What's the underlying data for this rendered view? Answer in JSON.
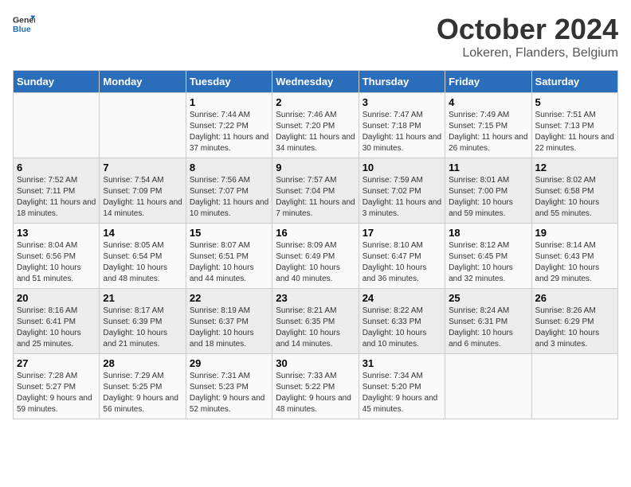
{
  "header": {
    "logo_line1": "General",
    "logo_line2": "Blue",
    "month": "October 2024",
    "location": "Lokeren, Flanders, Belgium"
  },
  "weekdays": [
    "Sunday",
    "Monday",
    "Tuesday",
    "Wednesday",
    "Thursday",
    "Friday",
    "Saturday"
  ],
  "weeks": [
    [
      {
        "day": "",
        "sunrise": "",
        "sunset": "",
        "daylight": ""
      },
      {
        "day": "",
        "sunrise": "",
        "sunset": "",
        "daylight": ""
      },
      {
        "day": "1",
        "sunrise": "Sunrise: 7:44 AM",
        "sunset": "Sunset: 7:22 PM",
        "daylight": "Daylight: 11 hours and 37 minutes."
      },
      {
        "day": "2",
        "sunrise": "Sunrise: 7:46 AM",
        "sunset": "Sunset: 7:20 PM",
        "daylight": "Daylight: 11 hours and 34 minutes."
      },
      {
        "day": "3",
        "sunrise": "Sunrise: 7:47 AM",
        "sunset": "Sunset: 7:18 PM",
        "daylight": "Daylight: 11 hours and 30 minutes."
      },
      {
        "day": "4",
        "sunrise": "Sunrise: 7:49 AM",
        "sunset": "Sunset: 7:15 PM",
        "daylight": "Daylight: 11 hours and 26 minutes."
      },
      {
        "day": "5",
        "sunrise": "Sunrise: 7:51 AM",
        "sunset": "Sunset: 7:13 PM",
        "daylight": "Daylight: 11 hours and 22 minutes."
      }
    ],
    [
      {
        "day": "6",
        "sunrise": "Sunrise: 7:52 AM",
        "sunset": "Sunset: 7:11 PM",
        "daylight": "Daylight: 11 hours and 18 minutes."
      },
      {
        "day": "7",
        "sunrise": "Sunrise: 7:54 AM",
        "sunset": "Sunset: 7:09 PM",
        "daylight": "Daylight: 11 hours and 14 minutes."
      },
      {
        "day": "8",
        "sunrise": "Sunrise: 7:56 AM",
        "sunset": "Sunset: 7:07 PM",
        "daylight": "Daylight: 11 hours and 10 minutes."
      },
      {
        "day": "9",
        "sunrise": "Sunrise: 7:57 AM",
        "sunset": "Sunset: 7:04 PM",
        "daylight": "Daylight: 11 hours and 7 minutes."
      },
      {
        "day": "10",
        "sunrise": "Sunrise: 7:59 AM",
        "sunset": "Sunset: 7:02 PM",
        "daylight": "Daylight: 11 hours and 3 minutes."
      },
      {
        "day": "11",
        "sunrise": "Sunrise: 8:01 AM",
        "sunset": "Sunset: 7:00 PM",
        "daylight": "Daylight: 10 hours and 59 minutes."
      },
      {
        "day": "12",
        "sunrise": "Sunrise: 8:02 AM",
        "sunset": "Sunset: 6:58 PM",
        "daylight": "Daylight: 10 hours and 55 minutes."
      }
    ],
    [
      {
        "day": "13",
        "sunrise": "Sunrise: 8:04 AM",
        "sunset": "Sunset: 6:56 PM",
        "daylight": "Daylight: 10 hours and 51 minutes."
      },
      {
        "day": "14",
        "sunrise": "Sunrise: 8:05 AM",
        "sunset": "Sunset: 6:54 PM",
        "daylight": "Daylight: 10 hours and 48 minutes."
      },
      {
        "day": "15",
        "sunrise": "Sunrise: 8:07 AM",
        "sunset": "Sunset: 6:51 PM",
        "daylight": "Daylight: 10 hours and 44 minutes."
      },
      {
        "day": "16",
        "sunrise": "Sunrise: 8:09 AM",
        "sunset": "Sunset: 6:49 PM",
        "daylight": "Daylight: 10 hours and 40 minutes."
      },
      {
        "day": "17",
        "sunrise": "Sunrise: 8:10 AM",
        "sunset": "Sunset: 6:47 PM",
        "daylight": "Daylight: 10 hours and 36 minutes."
      },
      {
        "day": "18",
        "sunrise": "Sunrise: 8:12 AM",
        "sunset": "Sunset: 6:45 PM",
        "daylight": "Daylight: 10 hours and 32 minutes."
      },
      {
        "day": "19",
        "sunrise": "Sunrise: 8:14 AM",
        "sunset": "Sunset: 6:43 PM",
        "daylight": "Daylight: 10 hours and 29 minutes."
      }
    ],
    [
      {
        "day": "20",
        "sunrise": "Sunrise: 8:16 AM",
        "sunset": "Sunset: 6:41 PM",
        "daylight": "Daylight: 10 hours and 25 minutes."
      },
      {
        "day": "21",
        "sunrise": "Sunrise: 8:17 AM",
        "sunset": "Sunset: 6:39 PM",
        "daylight": "Daylight: 10 hours and 21 minutes."
      },
      {
        "day": "22",
        "sunrise": "Sunrise: 8:19 AM",
        "sunset": "Sunset: 6:37 PM",
        "daylight": "Daylight: 10 hours and 18 minutes."
      },
      {
        "day": "23",
        "sunrise": "Sunrise: 8:21 AM",
        "sunset": "Sunset: 6:35 PM",
        "daylight": "Daylight: 10 hours and 14 minutes."
      },
      {
        "day": "24",
        "sunrise": "Sunrise: 8:22 AM",
        "sunset": "Sunset: 6:33 PM",
        "daylight": "Daylight: 10 hours and 10 minutes."
      },
      {
        "day": "25",
        "sunrise": "Sunrise: 8:24 AM",
        "sunset": "Sunset: 6:31 PM",
        "daylight": "Daylight: 10 hours and 6 minutes."
      },
      {
        "day": "26",
        "sunrise": "Sunrise: 8:26 AM",
        "sunset": "Sunset: 6:29 PM",
        "daylight": "Daylight: 10 hours and 3 minutes."
      }
    ],
    [
      {
        "day": "27",
        "sunrise": "Sunrise: 7:28 AM",
        "sunset": "Sunset: 5:27 PM",
        "daylight": "Daylight: 9 hours and 59 minutes."
      },
      {
        "day": "28",
        "sunrise": "Sunrise: 7:29 AM",
        "sunset": "Sunset: 5:25 PM",
        "daylight": "Daylight: 9 hours and 56 minutes."
      },
      {
        "day": "29",
        "sunrise": "Sunrise: 7:31 AM",
        "sunset": "Sunset: 5:23 PM",
        "daylight": "Daylight: 9 hours and 52 minutes."
      },
      {
        "day": "30",
        "sunrise": "Sunrise: 7:33 AM",
        "sunset": "Sunset: 5:22 PM",
        "daylight": "Daylight: 9 hours and 48 minutes."
      },
      {
        "day": "31",
        "sunrise": "Sunrise: 7:34 AM",
        "sunset": "Sunset: 5:20 PM",
        "daylight": "Daylight: 9 hours and 45 minutes."
      },
      {
        "day": "",
        "sunrise": "",
        "sunset": "",
        "daylight": ""
      },
      {
        "day": "",
        "sunrise": "",
        "sunset": "",
        "daylight": ""
      }
    ]
  ]
}
